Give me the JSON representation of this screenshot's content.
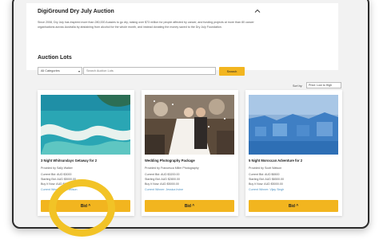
{
  "header": {
    "title": "DigiGround Dry July Auction",
    "description": "Since 2008, Dry July has inspired more than 280,000 Aussies to go dry, raising over $73 million for people affected by cancer, and funding projects at more than 80 cancer organisations across Australia by abstaining from alcohol for the whole month, and instead donating the money saved to the Dry July Foundation."
  },
  "lots": {
    "title": "Auction Lots",
    "category_value": "All Categories",
    "search_placeholder": "Search Auction Lots",
    "search_button": "Search",
    "sort_label": "Sort by:",
    "sort_value": "Price: Low to High"
  },
  "cards": [
    {
      "title": "3 Night Whitsundays Getaway for 2",
      "provider": "Provided by Sally Walker",
      "current_bid": "Current Bid: AUD $3000",
      "starting_bid": "Starting Bid: AUD $5000.00",
      "buy_now": "Buy It Now: AUD $8000.00",
      "winner": "Current Winner: Sam Wilson",
      "bid_label": "Bid ^"
    },
    {
      "title": "Wedding Photography Package",
      "provider": "Provided by Francesca Miller Photography",
      "current_bid": "Current Bid: AUD $3200.00",
      "starting_bid": "Starting Bid: AUD $2800.00",
      "buy_now": "Buy It Now: AUD $5000.00",
      "winner": "Current Winner: Jessica Irvine",
      "bid_label": "Bid ^"
    },
    {
      "title": "5 Night Moroccan Adventure for 2",
      "provider": "Provided by Scott Watson",
      "current_bid": "Current Bid: AUD $6500",
      "starting_bid": "Starting Bid: AUD $6500.00",
      "buy_now": "Buy It Now: AUD $5000.00",
      "winner": "Current Winner: Vijay Singh",
      "bid_label": "Bid ^"
    }
  ],
  "colors": {
    "accent": "#f2b51f",
    "highlight": "#f2c326",
    "link": "#4a90c2"
  }
}
